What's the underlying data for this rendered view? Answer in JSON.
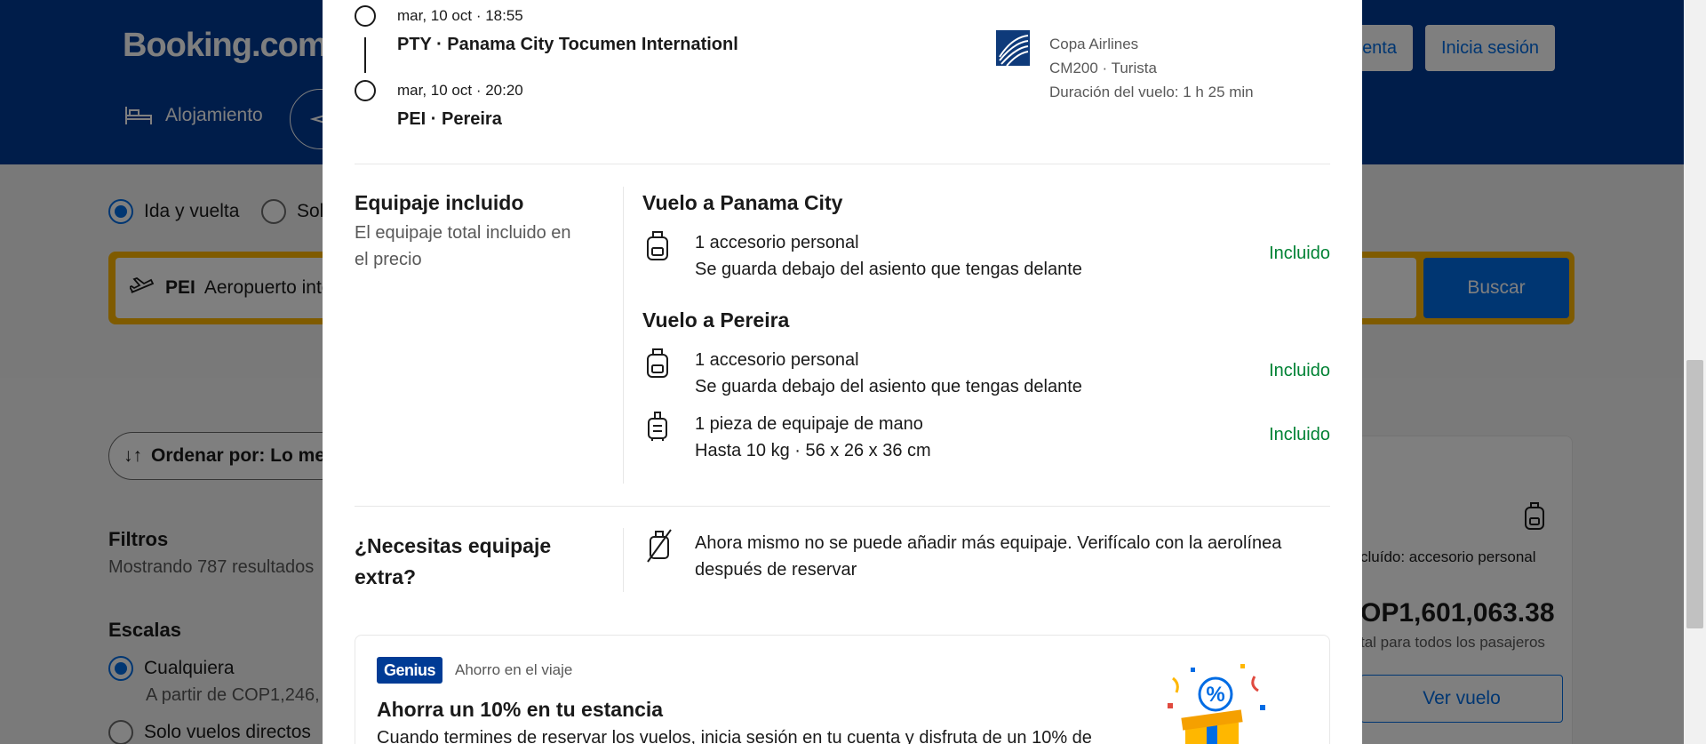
{
  "background": {
    "logo": "Booking.com",
    "register_label": "enta",
    "login_label": "Inicia sesión",
    "nav_stays": "Alojamiento",
    "trip_type_round": "Ida y vuelta",
    "trip_type_oneway": "Sol",
    "origin_code": "PEI",
    "origin_name": "Aeropuerto inte",
    "search_label": "Buscar",
    "sort_label": "Ordenar por: Lo me",
    "filters_title": "Filtros",
    "filters_count": "Mostrando 787 resultados",
    "stops_title": "Escalas",
    "stops_any": "Cualquiera",
    "stops_any_price": "A partir de COP1,246,",
    "stops_direct": "Solo vuelos directos",
    "card_included": "cluído: accesorio personal",
    "card_price": "OP1,601,063.38",
    "card_price_sub": "tal para todos los pasajeros",
    "card_view": "Ver vuelo"
  },
  "segment": {
    "dep_time": "mar, 10 oct · 18:55",
    "dep_airport": "PTY · Panama City Tocumen Internationl",
    "arr_time": "mar, 10 oct · 20:20",
    "arr_airport": "PEI · Pereira",
    "airline": "Copa Airlines",
    "flight_class": "CM200 · Turista",
    "duration": "Duración del vuelo: 1 h 25 min"
  },
  "luggage": {
    "title": "Equipaje incluido",
    "subtitle_line1": "El equipaje total incluido en",
    "subtitle_line2": "el precio",
    "flights": [
      {
        "title": "Vuelo a Panama City",
        "items": [
          {
            "icon": "backpack-icon",
            "name": "1 accesorio personal",
            "detail": "Se guarda debajo del asiento que tengas delante",
            "status": "Incluido"
          }
        ]
      },
      {
        "title": "Vuelo a Pereira",
        "items": [
          {
            "icon": "backpack-icon",
            "name": "1 accesorio personal",
            "detail": "Se guarda debajo del asiento que tengas delante",
            "status": "Incluido"
          },
          {
            "icon": "suitcase-icon",
            "name": "1 pieza de equipaje de mano",
            "detail": "Hasta 10 kg · 56 x 26 x 36 cm",
            "status": "Incluido"
          }
        ]
      }
    ]
  },
  "extra": {
    "title_line1": "¿Necesitas equipaje",
    "title_line2": "extra?",
    "text_line1": "Ahora mismo no se puede añadir más equipaje. Verifícalo con la aerolínea",
    "text_line2": "después de reservar"
  },
  "genius": {
    "badge": "Genius",
    "tag": "Ahorro en el viaje",
    "title": "Ahorra un 10% en tu estancia",
    "desc": "Cuando termines de reservar los vuelos, inicia sesión en tu cuenta y disfruta de un 10% de"
  },
  "colors": {
    "brand_blue": "#003b95",
    "action_blue": "#006ce4",
    "included_green": "#008234",
    "search_yellow": "#ffb700"
  }
}
